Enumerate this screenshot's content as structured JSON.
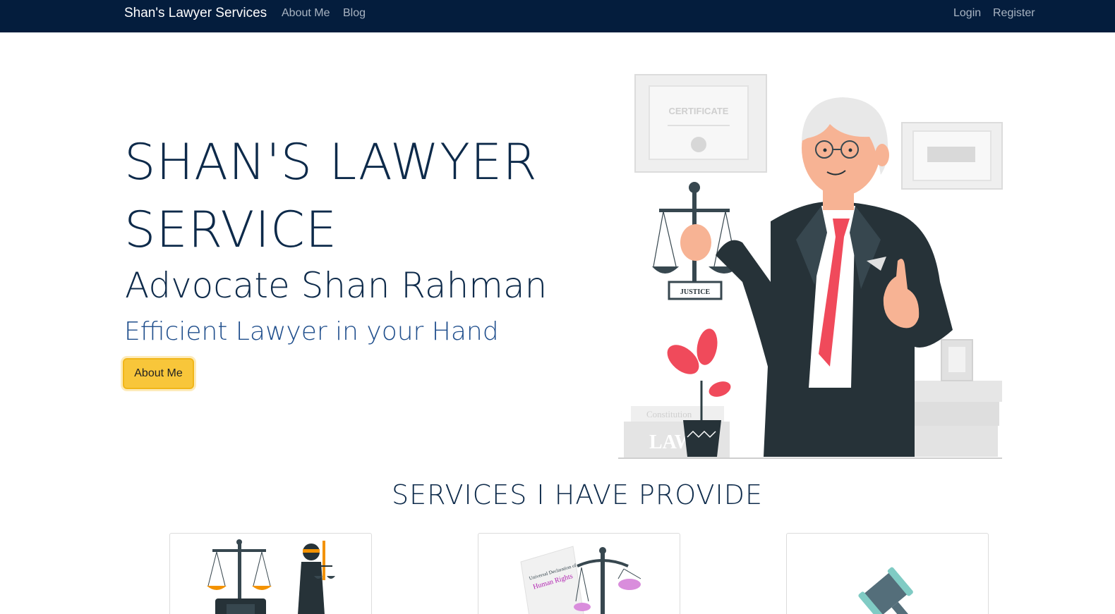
{
  "navbar": {
    "brand": "Shan's Lawyer Services",
    "links": [
      "About Me",
      "Blog"
    ],
    "auth": [
      "Login",
      "Register"
    ]
  },
  "hero": {
    "title_line1": "SHAN'S LAWYER",
    "title_line2": "SERVICE",
    "subtitle": "Advocate Shan Rahman",
    "tagline": "Efficient Lawyer in your Hand",
    "button": "About Me",
    "illustration_text": {
      "certificate": "CERTIFICATE",
      "justice": "JUSTICE",
      "law": "LAW",
      "constitution": "Constitution"
    }
  },
  "services": {
    "title": "SERVICES I HAVE PROVIDE",
    "card2_text": {
      "line1": "Universal Declaration of",
      "line2": "Human Rights"
    }
  },
  "colors": {
    "navbar": "#041d3d",
    "primary_text": "#0d2a4a",
    "tagline": "#1f4e8c",
    "button": "#f8c63a"
  }
}
